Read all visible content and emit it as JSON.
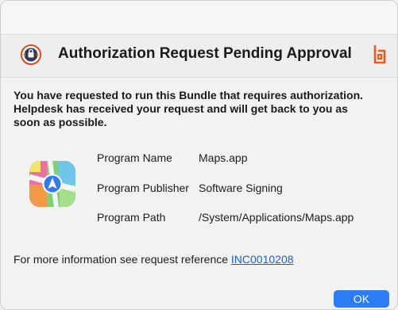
{
  "dialog": {
    "title": "Authorization Request Pending Approval",
    "message_lines": [
      "You have requested to run this Bundle that requires authorization.",
      "Helpdesk has received your request and will get back to you as",
      "soon as possible."
    ],
    "details": [
      {
        "label": "Program Name",
        "value": "Maps.app"
      },
      {
        "label": "Program Publisher",
        "value": "Software Signing"
      },
      {
        "label": "Program Path",
        "value": "/System/Applications/Maps.app"
      }
    ],
    "info_text": "For more information see request reference ",
    "reference_link": "INC0010208",
    "ok_label": "OK"
  },
  "icons": {
    "header": "authorization-lock-icon",
    "brand": "beyondtrust-logo-icon",
    "app": "maps-app-icon"
  },
  "colors": {
    "accent": "#2c7cf6",
    "link": "#1b5fd6",
    "brand": "#f05a1a"
  }
}
